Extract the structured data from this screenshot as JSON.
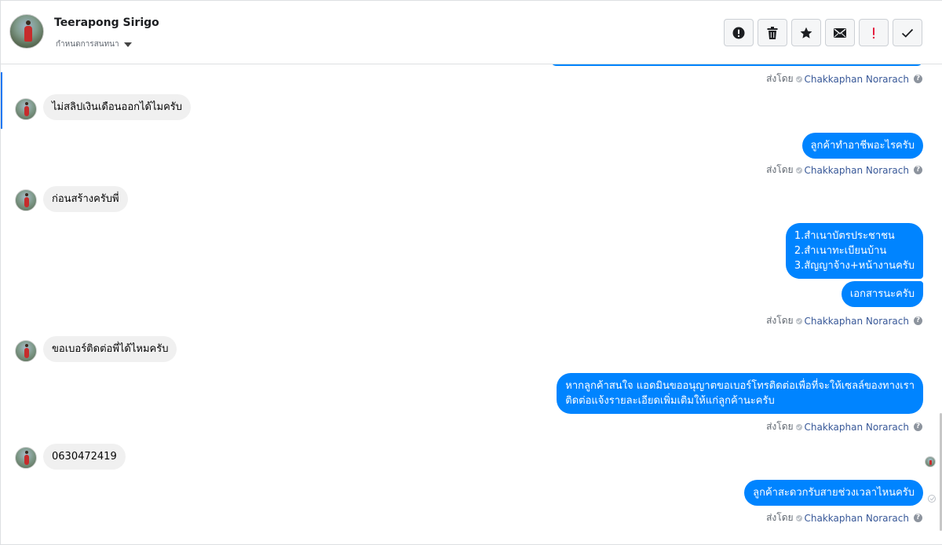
{
  "header": {
    "contact_name": "Teerapong Sirigo",
    "assign_label": "กำหนดการสนทนา",
    "toolbar": [
      {
        "name": "spam-button",
        "icon": "alert-circle-icon"
      },
      {
        "name": "delete-button",
        "icon": "trash-icon"
      },
      {
        "name": "star-button",
        "icon": "star-icon"
      },
      {
        "name": "mark-unread-button",
        "icon": "envelope-icon"
      },
      {
        "name": "important-button",
        "icon": "exclamation-icon"
      },
      {
        "name": "done-button",
        "icon": "check-icon"
      }
    ]
  },
  "sent_by": {
    "prefix": "ส่งโดย",
    "agent": "Chakkaphan Norarach",
    "help": "?"
  },
  "messages": [
    {
      "id": "m1",
      "dir": "in",
      "text": "ไม่สลิปเงินเดือนออกได้ไมครับ"
    },
    {
      "id": "m2",
      "dir": "out",
      "text": "ลูกค้าทำอาชีพอะไรครับ"
    },
    {
      "id": "m3",
      "dir": "in",
      "text": "ก่อนสร้างครับพี่"
    },
    {
      "id": "m4",
      "dir": "out",
      "text": "1.สำเนาบัตรประชาชน\n2.สำเนาทะเบียนบ้าน\n3.สัญญาจ้าง+หน้างานครับ"
    },
    {
      "id": "m5",
      "dir": "out",
      "text": "เอกสารนะครับ"
    },
    {
      "id": "m6",
      "dir": "in",
      "text": "ขอเบอร์ติดต่อพี่ได้ไหมครับ"
    },
    {
      "id": "m7",
      "dir": "out",
      "text": "หากลูกค้าสนใจ แอดมินขออนุญาตขอเบอร์โทรติดต่อเพื่อที่จะให้เซลล์ของทางเรา\nติดต่อแจ้งรายละเอียดเพิ่มเติมให้แก่ลูกค้านะครับ"
    },
    {
      "id": "m8",
      "dir": "in",
      "text": "0630472419"
    },
    {
      "id": "m9",
      "dir": "out",
      "text": "ลูกค้าสะดวกรับสายช่วงเวลาไหนครับ"
    }
  ]
}
